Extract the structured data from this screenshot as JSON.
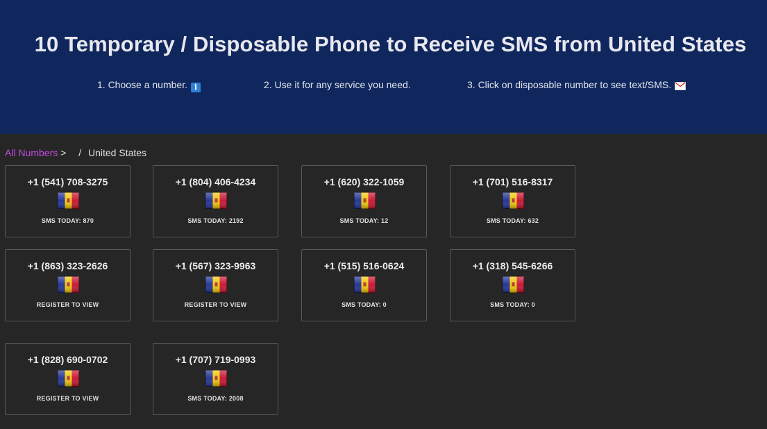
{
  "hero": {
    "title": "10 Temporary / Disposable Phone to Receive SMS from United States",
    "steps": [
      "1. Choose a number.",
      "2. Use it for any service you need.",
      "3. Click on disposable number to see text/SMS."
    ],
    "icons": [
      "info-icon",
      "envelope-icon"
    ]
  },
  "breadcrumb": {
    "link": "All Numbers",
    "separator": ">",
    "divider": "/",
    "current": "United States"
  },
  "colors": {
    "hero_bg": "#10275e",
    "page_bg": "#262626",
    "link": "#c34be0",
    "flag": [
      "#1d2f8f",
      "#f2c500",
      "#c8102e"
    ]
  },
  "numbers": [
    {
      "number": "+1 (541) 708-3275",
      "status": "SMS TODAY: 870"
    },
    {
      "number": "+1 (804) 406-4234",
      "status": "SMS TODAY: 2192"
    },
    {
      "number": "+1 (620) 322-1059",
      "status": "SMS TODAY: 12"
    },
    {
      "number": "+1 (701) 516-8317",
      "status": "SMS TODAY: 632"
    },
    {
      "number": "+1 (863) 323-2626",
      "status": "REGISTER TO VIEW"
    },
    {
      "number": "+1 (567) 323-9963",
      "status": "REGISTER TO VIEW"
    },
    {
      "number": "+1 (515) 516-0624",
      "status": "SMS TODAY: 0"
    },
    {
      "number": "+1 (318) 545-6266",
      "status": "SMS TODAY: 0"
    },
    {
      "number": "+1 (828) 690-0702",
      "status": "REGISTER TO VIEW"
    },
    {
      "number": "+1 (707) 719-0993",
      "status": "SMS TODAY: 2008"
    }
  ]
}
